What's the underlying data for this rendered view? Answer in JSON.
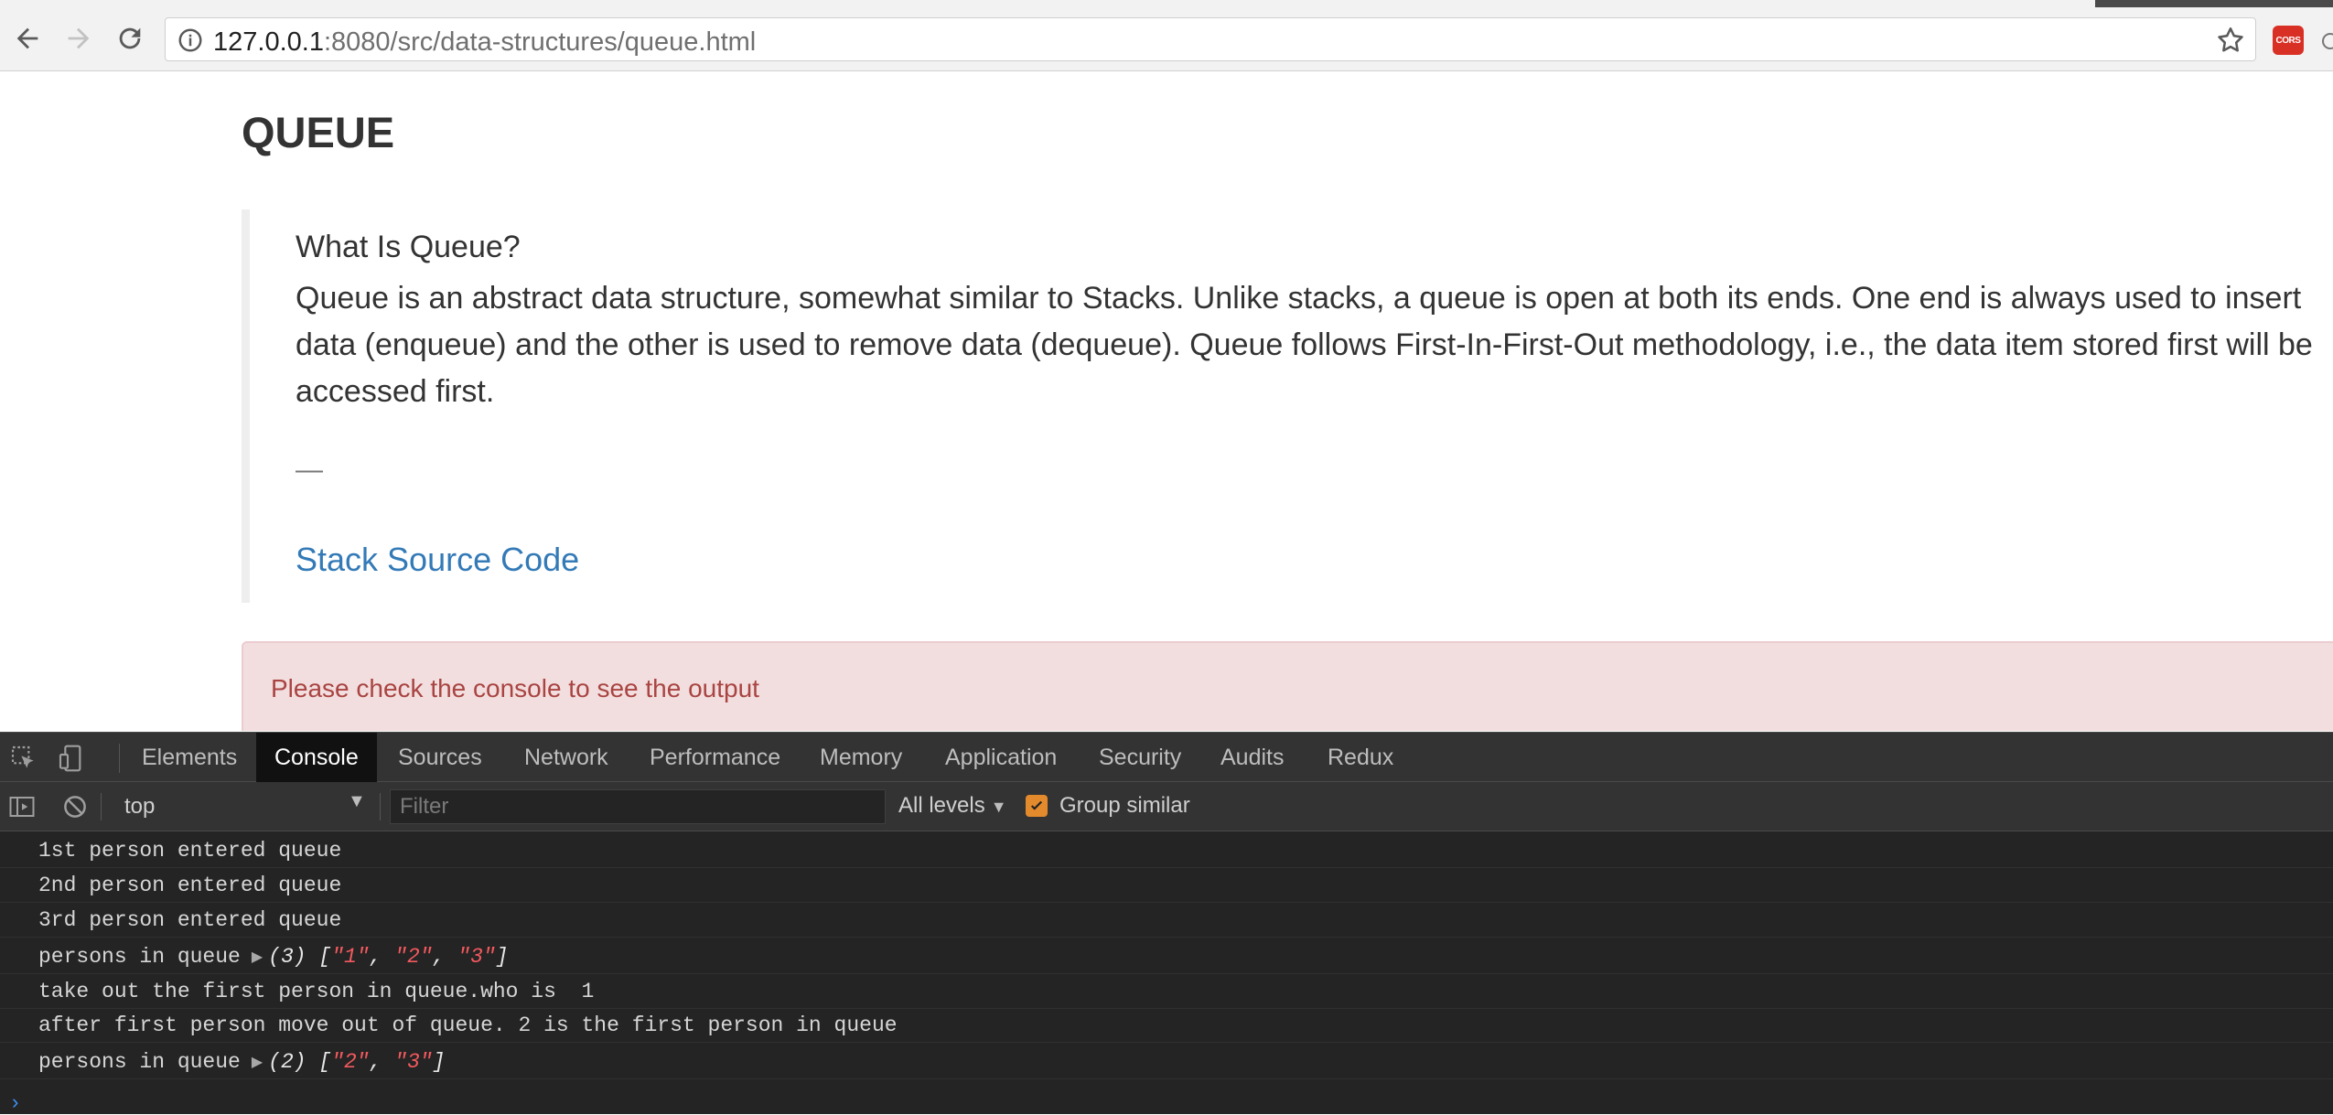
{
  "browser": {
    "url_host": "127.0.0.1",
    "url_path": ":8080/src/data-structures/queue.html",
    "extension_badge": "CORS"
  },
  "page": {
    "title": "QUEUE",
    "quote_heading": "What Is Queue?",
    "quote_body": "Queue is an abstract data structure, somewhat similar to Stacks. Unlike stacks, a queue is open at both its ends. One end is always used to insert data (enqueue) and the other is used to remove data (dequeue). Queue follows First-In-First-Out methodology, i.e., the data item stored first will be accessed first.",
    "quote_dash": "—",
    "link_label": "Stack Source Code",
    "alert_text": "Please check the console to see the output"
  },
  "devtools": {
    "tabs": [
      "Elements",
      "Console",
      "Sources",
      "Network",
      "Performance",
      "Memory",
      "Application",
      "Security",
      "Audits",
      "Redux"
    ],
    "active_tab": "Console",
    "context": "top",
    "filter_placeholder": "Filter",
    "levels_label": "All levels",
    "group_similar_label": "Group similar",
    "group_similar_checked": true,
    "accent_color": "#e38b2c",
    "console_lines": [
      {
        "text": "1st person entered queue"
      },
      {
        "text": "2nd person entered queue"
      },
      {
        "text": "3rd person entered queue"
      },
      {
        "prefix": "persons in queue ",
        "count": "(3)",
        "items": [
          "\"1\"",
          "\"2\"",
          "\"3\""
        ]
      },
      {
        "text": "take out the first person in queue.who is  1"
      },
      {
        "text": "after first person move out of queue. 2 is the first person in queue"
      },
      {
        "prefix": "persons in queue ",
        "count": "(2)",
        "items": [
          "\"2\"",
          "\"3\""
        ]
      }
    ],
    "prompt_symbol": "›"
  }
}
